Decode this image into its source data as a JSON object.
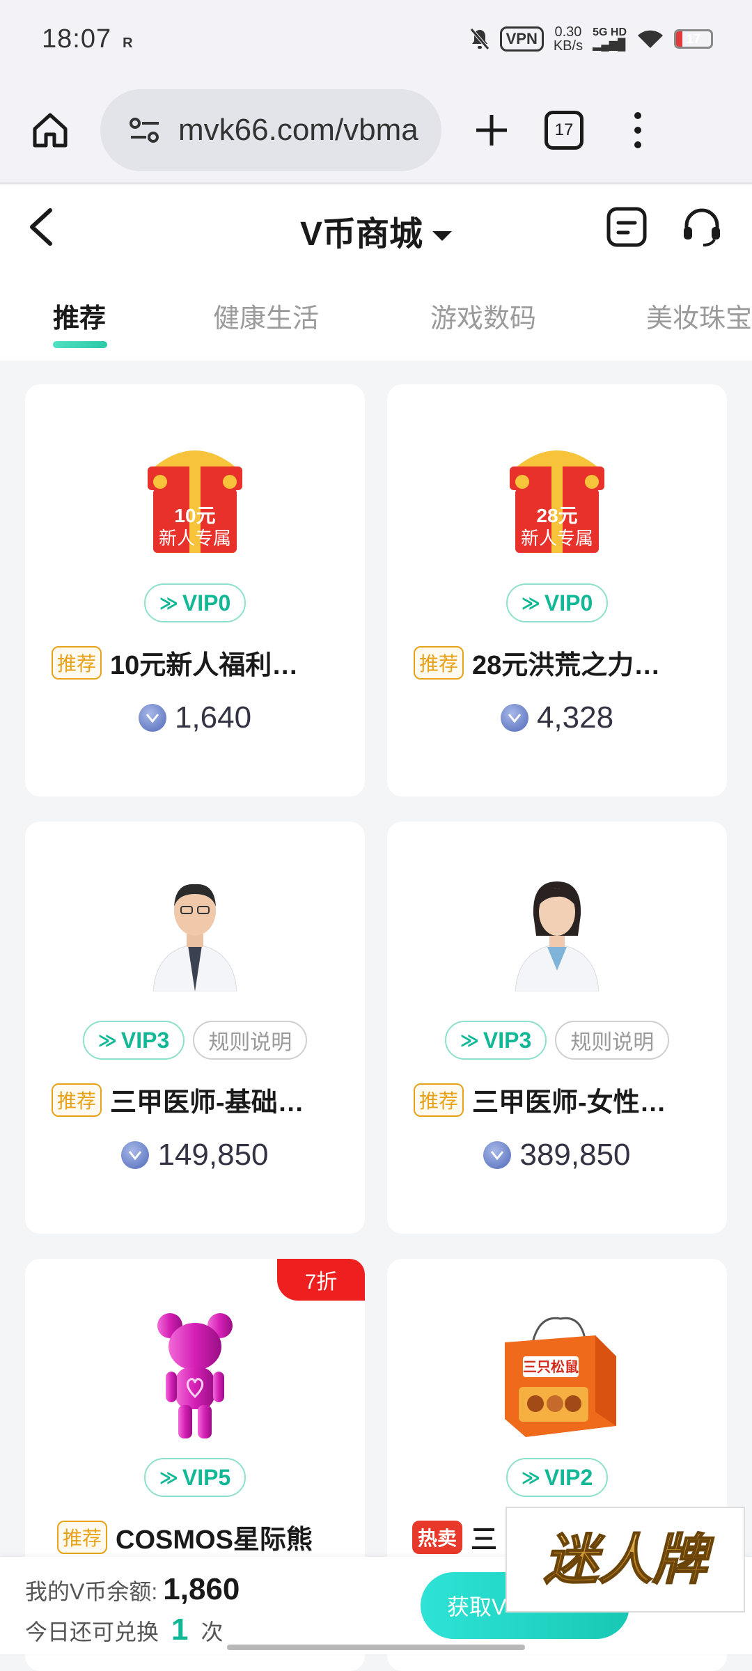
{
  "status": {
    "time": "18:07",
    "r_mark": "R",
    "vpn": "VPN",
    "speed_value": "0.30",
    "speed_unit": "KB/s",
    "network": "5G HD",
    "battery": "17",
    "battery_level": 0.17
  },
  "browser": {
    "url": "mvk66.com/vbma",
    "tab_count": "17"
  },
  "header": {
    "title": "V币商城"
  },
  "tabs": [
    "推荐",
    "健康生活",
    "游戏数码",
    "美妆珠宝"
  ],
  "products": [
    {
      "pic_label_1": "10元",
      "pic_label_2": "新人专属",
      "vip": "VIP0",
      "rule": "",
      "tag": "推荐",
      "name": "10元新人福利…",
      "price": "1,640",
      "discount": ""
    },
    {
      "pic_label_1": "28元",
      "pic_label_2": "新人专属",
      "vip": "VIP0",
      "rule": "",
      "tag": "推荐",
      "name": "28元洪荒之力…",
      "price": "4,328",
      "discount": ""
    },
    {
      "vip": "VIP3",
      "rule": "规则说明",
      "tag": "推荐",
      "name": "三甲医师-基础…",
      "price": "149,850",
      "discount": ""
    },
    {
      "vip": "VIP3",
      "rule": "规则说明",
      "tag": "推荐",
      "name": "三甲医师-女性…",
      "price": "389,850",
      "discount": ""
    },
    {
      "vip": "VIP5",
      "rule": "",
      "tag": "推荐",
      "name": "COSMOS星际熊",
      "price": "",
      "discount": "7折"
    },
    {
      "pic_label_1": "三只松鼠",
      "vip": "VIP2",
      "rule": "",
      "tag": "热卖",
      "name": "三",
      "price": "",
      "discount": ""
    }
  ],
  "bottom": {
    "balance_label": "我的V币余额:",
    "balance": "1,860",
    "today_label": "今日还可兑换",
    "today_count": "1",
    "today_unit": "次",
    "get_button": "获取V"
  },
  "watermark": "迷人牌",
  "colors": {
    "accent": "#12b896",
    "tag": "#e7a21a",
    "hot": "#e8382a",
    "discount": "#ee1f1f"
  }
}
